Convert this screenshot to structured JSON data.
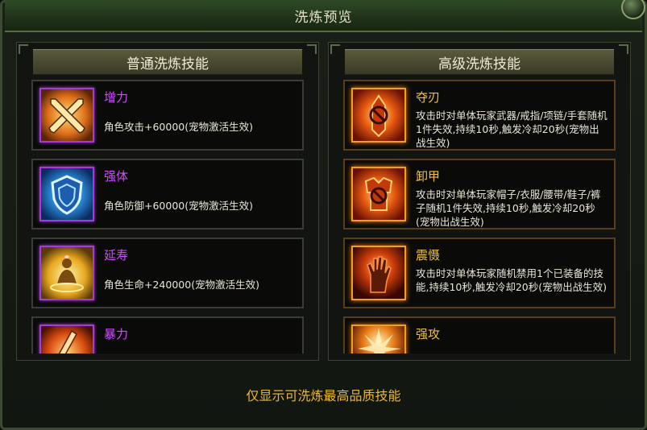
{
  "window": {
    "title": "洗炼预览"
  },
  "left_panel": {
    "title": "普通洗炼技能",
    "skills": [
      {
        "name": "增力",
        "desc": "角色攻击+60000(宠物激活生效)",
        "icon": "crossed-swords-icon"
      },
      {
        "name": "强体",
        "desc": "角色防御+60000(宠物激活生效)",
        "icon": "shield-icon"
      },
      {
        "name": "延寿",
        "desc": "角色生命+240000(宠物激活生效)",
        "icon": "meditating-figure-icon"
      },
      {
        "name": "暴力",
        "desc": "",
        "icon": "sword-icon"
      }
    ]
  },
  "right_panel": {
    "title": "高级洗炼技能",
    "skills": [
      {
        "name": "夺刃",
        "desc": "攻击时对单体玩家武器/戒指/项链/手套随机1件失效,持续10秒,触发冷却20秒(宠物出战生效)",
        "icon": "disabled-sword-icon"
      },
      {
        "name": "卸甲",
        "desc": "攻击时对单体玩家帽子/衣服/腰带/鞋子/裤子随机1件失效,持续10秒,触发冷却20秒(宠物出战生效)",
        "icon": "disabled-armor-icon"
      },
      {
        "name": "震慑",
        "desc": "攻击时对单体玩家随机禁用1个已装备的技能,持续10秒,触发冷却20秒(宠物出战生效)",
        "icon": "flaming-hand-icon"
      },
      {
        "name": "强攻",
        "desc": "",
        "icon": "burst-icon"
      }
    ]
  },
  "footer": {
    "note": "仅显示可洗炼最高品质技能"
  },
  "colors": {
    "normal_name": "#d04cff",
    "advanced_name": "#f0c040",
    "footer": "#e8b830"
  }
}
